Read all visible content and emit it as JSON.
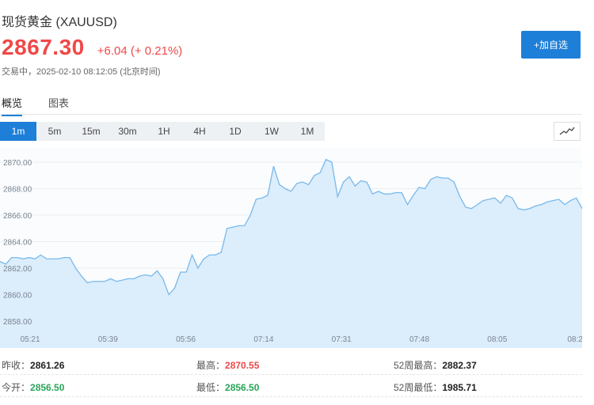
{
  "header": {
    "title": "现货黄金 (XAUUSD)",
    "price": "2867.30",
    "change": "+6.04 (+ 0.21%)",
    "status": "交易中，2025-02-10 08:12:05 (北京时间)",
    "add_button": "+加自选"
  },
  "tabs": [
    {
      "label": "概览",
      "active": true
    },
    {
      "label": "图表",
      "active": false
    }
  ],
  "periods": [
    {
      "label": "1m",
      "active": true
    },
    {
      "label": "5m",
      "active": false
    },
    {
      "label": "15m",
      "active": false
    },
    {
      "label": "30m",
      "active": false
    },
    {
      "label": "1H",
      "active": false
    },
    {
      "label": "4H",
      "active": false
    },
    {
      "label": "1D",
      "active": false
    },
    {
      "label": "1W",
      "active": false
    },
    {
      "label": "1M",
      "active": false
    }
  ],
  "chart_icon": "line-chart-icon",
  "colors": {
    "accent": "#1e7fd8",
    "up": "#f04848",
    "down": "#2aa55a",
    "line": "#79b9ea",
    "fill": "#dcedfb"
  },
  "chart_data": {
    "type": "area",
    "ylim": [
      2857,
      2871
    ],
    "y_ticks": [
      "2870.00",
      "2868.00",
      "2866.00",
      "2864.00",
      "2862.00",
      "2860.00",
      "2858.00"
    ],
    "x_ticks": [
      "05:21",
      "05:39",
      "05:56",
      "07:14",
      "07:31",
      "07:48",
      "08:05",
      "08:2"
    ],
    "x": [
      0,
      1,
      2,
      3,
      4,
      5,
      6,
      7,
      8,
      9,
      10,
      11,
      12,
      13,
      14,
      15,
      16,
      17,
      18,
      19,
      20,
      21,
      22,
      23,
      24,
      25,
      26,
      27,
      28,
      29,
      30,
      31,
      32,
      33,
      34,
      35,
      36,
      37,
      38,
      39,
      40,
      41,
      42,
      43,
      44,
      45,
      46,
      47,
      48,
      49,
      50,
      51,
      52,
      53,
      54,
      55,
      56,
      57,
      58,
      59,
      60,
      61,
      62,
      63,
      64,
      65,
      66,
      67,
      68,
      69,
      70,
      71,
      72,
      73,
      74,
      75,
      76,
      77,
      78,
      79,
      80,
      81,
      82,
      83,
      84,
      85,
      86,
      87,
      88,
      89,
      90,
      91,
      92,
      93,
      94,
      95,
      96,
      97,
      98,
      99,
      100
    ],
    "values": [
      2862.5,
      2862.3,
      2862.8,
      2862.8,
      2862.7,
      2862.8,
      2862.7,
      2863.0,
      2862.7,
      2862.7,
      2862.7,
      2862.8,
      2862.8,
      2862.0,
      2861.4,
      2860.9,
      2861.0,
      2861.0,
      2861.0,
      2861.2,
      2861.0,
      2861.1,
      2861.2,
      2861.2,
      2861.4,
      2861.5,
      2861.4,
      2861.8,
      2861.2,
      2860.0,
      2860.5,
      2861.7,
      2861.7,
      2863.0,
      2862.0,
      2862.7,
      2863.0,
      2863.0,
      2863.2,
      2865.0,
      2865.1,
      2865.2,
      2865.2,
      2866.0,
      2867.2,
      2867.3,
      2867.5,
      2869.7,
      2868.3,
      2868.0,
      2867.8,
      2868.4,
      2868.5,
      2868.3,
      2869.0,
      2869.2,
      2870.2,
      2870.0,
      2867.4,
      2868.5,
      2868.9,
      2868.2,
      2868.6,
      2868.5,
      2867.6,
      2867.8,
      2867.6,
      2867.6,
      2867.7,
      2867.7,
      2866.8,
      2867.5,
      2868.1,
      2868.0,
      2868.7,
      2868.9,
      2868.8,
      2868.8,
      2868.5,
      2867.4,
      2866.6,
      2866.5,
      2866.8,
      2867.1,
      2867.2,
      2867.3,
      2866.9,
      2867.5,
      2867.3,
      2866.5,
      2866.4,
      2866.5,
      2866.7,
      2866.8,
      2867.0,
      2867.1,
      2867.2,
      2866.8,
      2867.1,
      2867.3,
      2866.5
    ]
  },
  "stats": [
    [
      {
        "label": "昨收：",
        "value": "2861.26",
        "color": "dark"
      },
      {
        "label": "最高：",
        "value": "2870.55",
        "color": "red"
      },
      {
        "label": "52周最高：",
        "value": "2882.37",
        "color": "dark"
      }
    ],
    [
      {
        "label": "今开：",
        "value": "2856.50",
        "color": "green"
      },
      {
        "label": "最低：",
        "value": "2856.50",
        "color": "green"
      },
      {
        "label": "52周最低：",
        "value": "1985.71",
        "color": "dark"
      }
    ]
  ]
}
